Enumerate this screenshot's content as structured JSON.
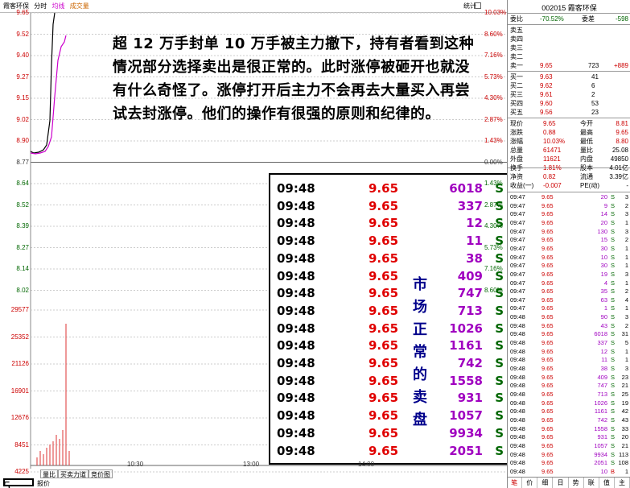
{
  "chart": {
    "stock_name": "霞客环保",
    "tab_time": "分时",
    "tab_avg": "均线",
    "tab_vol": "成交量",
    "stats_label": "统计",
    "price_ticks": [
      "9.65",
      "9.52",
      "9.40",
      "9.27",
      "9.15",
      "9.02",
      "8.90",
      "8.77",
      "8.64",
      "8.52",
      "8.39",
      "8.27",
      "8.14",
      "8.02"
    ],
    "pct_ticks": [
      "10.03%",
      "8.60%",
      "7.16%",
      "5.73%",
      "4.30%",
      "2.87%",
      "1.43%",
      "0.00%",
      "1.43%",
      "2.87%",
      "4.30%",
      "5.73%",
      "7.16%",
      "8.60%"
    ],
    "vol_ticks": [
      "29577",
      "25352",
      "21126",
      "16901",
      "12676",
      "8451",
      "4225"
    ],
    "time_ticks": [
      "10:30",
      "13:00",
      "14:00"
    ],
    "bottom_tabs": [
      "量比",
      "买卖力道",
      "竞价图"
    ],
    "bottom_label": "报价",
    "slide_number": "5"
  },
  "overlay": {
    "text": "超 12 万手封单 10 万手被主力撤下，持有者看到这种情况部分选择卖出是很正常的。此时涨停被砸开也就没有什么奇怪了。涨停打开后主力不会再去大量买入再尝试去封涨停。他们的操作有很强的原则和纪律的。",
    "vertical_label": [
      "市",
      "场",
      "正",
      "常",
      "的",
      "卖",
      "盘"
    ]
  },
  "trades": [
    {
      "time": "09:48",
      "price": "9.65",
      "vol": "6018",
      "side": "S"
    },
    {
      "time": "09:48",
      "price": "9.65",
      "vol": "337",
      "side": "S"
    },
    {
      "time": "09:48",
      "price": "9.65",
      "vol": "12",
      "side": "S"
    },
    {
      "time": "09:48",
      "price": "9.65",
      "vol": "11",
      "side": "S"
    },
    {
      "time": "09:48",
      "price": "9.65",
      "vol": "38",
      "side": "S"
    },
    {
      "time": "09:48",
      "price": "9.65",
      "vol": "409",
      "side": "S"
    },
    {
      "time": "09:48",
      "price": "9.65",
      "vol": "747",
      "side": "S"
    },
    {
      "time": "09:48",
      "price": "9.65",
      "vol": "713",
      "side": "S"
    },
    {
      "time": "09:48",
      "price": "9.65",
      "vol": "1026",
      "side": "S"
    },
    {
      "time": "09:48",
      "price": "9.65",
      "vol": "1161",
      "side": "S"
    },
    {
      "time": "09:48",
      "price": "9.65",
      "vol": "742",
      "side": "S"
    },
    {
      "time": "09:48",
      "price": "9.65",
      "vol": "1558",
      "side": "S"
    },
    {
      "time": "09:48",
      "price": "9.65",
      "vol": "931",
      "side": "S"
    },
    {
      "time": "09:48",
      "price": "9.65",
      "vol": "1057",
      "side": "S"
    },
    {
      "time": "09:48",
      "price": "9.65",
      "vol": "9934",
      "side": "S"
    },
    {
      "time": "09:48",
      "price": "9.65",
      "vol": "2051",
      "side": "S"
    }
  ],
  "quote": {
    "title": "002015 霞客环保",
    "ratio_label": "委比",
    "ratio": "-70.52%",
    "diff_label": "委差",
    "diff": "-598",
    "sells": [
      {
        "label": "卖五",
        "price": "",
        "vol": "",
        "chg": ""
      },
      {
        "label": "卖四",
        "price": "",
        "vol": "",
        "chg": ""
      },
      {
        "label": "卖三",
        "price": "",
        "vol": "",
        "chg": ""
      },
      {
        "label": "卖二",
        "price": "",
        "vol": "",
        "chg": ""
      },
      {
        "label": "卖一",
        "price": "9.65",
        "vol": "723",
        "chg": "+889"
      }
    ],
    "buys": [
      {
        "label": "买一",
        "price": "9.63",
        "vol": "41",
        "chg": ""
      },
      {
        "label": "买二",
        "price": "9.62",
        "vol": "6",
        "chg": ""
      },
      {
        "label": "买三",
        "price": "9.61",
        "vol": "2",
        "chg": ""
      },
      {
        "label": "买四",
        "price": "9.60",
        "vol": "53",
        "chg": ""
      },
      {
        "label": "买五",
        "price": "9.56",
        "vol": "23",
        "chg": ""
      }
    ],
    "stats": [
      {
        "a": "现价",
        "b": "9.65",
        "c": "今开",
        "d": "8.81"
      },
      {
        "a": "涨跌",
        "b": "0.88",
        "c": "最高",
        "d": "9.65"
      },
      {
        "a": "涨幅",
        "b": "10.03%",
        "c": "最低",
        "d": "8.80"
      },
      {
        "a": "总量",
        "b": "61471",
        "c": "量比",
        "d": "25.08"
      },
      {
        "a": "外盘",
        "b": "11621",
        "c": "内盘",
        "d": "49850"
      },
      {
        "a": "换手",
        "b": "1.81%",
        "c": "股本",
        "d": "4.01亿"
      },
      {
        "a": "净资",
        "b": "0.82",
        "c": "流通",
        "d": "3.39亿"
      },
      {
        "a": "收益(一)",
        "b": "-0.007",
        "c": "PE(动)",
        "d": "-"
      }
    ],
    "ticks": [
      {
        "t": "09:47",
        "p": "9.65",
        "v": "20",
        "s": "S",
        "n": "3"
      },
      {
        "t": "09:47",
        "p": "9.65",
        "v": "9",
        "s": "S",
        "n": "2"
      },
      {
        "t": "09:47",
        "p": "9.65",
        "v": "14",
        "s": "S",
        "n": "3"
      },
      {
        "t": "09:47",
        "p": "9.65",
        "v": "20",
        "s": "S",
        "n": "1"
      },
      {
        "t": "09:47",
        "p": "9.65",
        "v": "130",
        "s": "S",
        "n": "3"
      },
      {
        "t": "09:47",
        "p": "9.65",
        "v": "15",
        "s": "S",
        "n": "2"
      },
      {
        "t": "09:47",
        "p": "9.65",
        "v": "30",
        "s": "S",
        "n": "1"
      },
      {
        "t": "09:47",
        "p": "9.65",
        "v": "10",
        "s": "S",
        "n": "1"
      },
      {
        "t": "09:47",
        "p": "9.65",
        "v": "30",
        "s": "S",
        "n": "1"
      },
      {
        "t": "09:47",
        "p": "9.65",
        "v": "19",
        "s": "S",
        "n": "3"
      },
      {
        "t": "09:47",
        "p": "9.65",
        "v": "4",
        "s": "S",
        "n": "1"
      },
      {
        "t": "09:47",
        "p": "9.65",
        "v": "35",
        "s": "S",
        "n": "2"
      },
      {
        "t": "09:47",
        "p": "9.65",
        "v": "63",
        "s": "S",
        "n": "4"
      },
      {
        "t": "09:47",
        "p": "9.65",
        "v": "1",
        "s": "S",
        "n": "1"
      },
      {
        "t": "09:48",
        "p": "9.65",
        "v": "90",
        "s": "S",
        "n": "3"
      },
      {
        "t": "09:48",
        "p": "9.65",
        "v": "43",
        "s": "S",
        "n": "2"
      },
      {
        "t": "09:48",
        "p": "9.65",
        "v": "6018",
        "s": "S",
        "n": "31"
      },
      {
        "t": "09:48",
        "p": "9.65",
        "v": "337",
        "s": "S",
        "n": "5"
      },
      {
        "t": "09:48",
        "p": "9.65",
        "v": "12",
        "s": "S",
        "n": "1"
      },
      {
        "t": "09:48",
        "p": "9.65",
        "v": "11",
        "s": "S",
        "n": "1"
      },
      {
        "t": "09:48",
        "p": "9.65",
        "v": "38",
        "s": "S",
        "n": "3"
      },
      {
        "t": "09:48",
        "p": "9.65",
        "v": "409",
        "s": "S",
        "n": "23"
      },
      {
        "t": "09:48",
        "p": "9.65",
        "v": "747",
        "s": "S",
        "n": "21"
      },
      {
        "t": "09:48",
        "p": "9.65",
        "v": "713",
        "s": "S",
        "n": "25"
      },
      {
        "t": "09:48",
        "p": "9.65",
        "v": "1026",
        "s": "S",
        "n": "19"
      },
      {
        "t": "09:48",
        "p": "9.65",
        "v": "1161",
        "s": "S",
        "n": "42"
      },
      {
        "t": "09:48",
        "p": "9.65",
        "v": "742",
        "s": "S",
        "n": "43"
      },
      {
        "t": "09:48",
        "p": "9.65",
        "v": "1558",
        "s": "S",
        "n": "33"
      },
      {
        "t": "09:48",
        "p": "9.65",
        "v": "931",
        "s": "S",
        "n": "20"
      },
      {
        "t": "09:48",
        "p": "9.65",
        "v": "1057",
        "s": "S",
        "n": "21"
      },
      {
        "t": "09:48",
        "p": "9.65",
        "v": "9934",
        "s": "S",
        "n": "113"
      },
      {
        "t": "09:48",
        "p": "9.65",
        "v": "2051",
        "s": "S",
        "n": "108"
      },
      {
        "t": "09:48",
        "p": "9.65",
        "v": "10",
        "s": "B",
        "n": "1"
      }
    ],
    "bottom_tabs": [
      "笔",
      "价",
      "细",
      "日",
      "势",
      "联",
      "值",
      "主"
    ]
  }
}
